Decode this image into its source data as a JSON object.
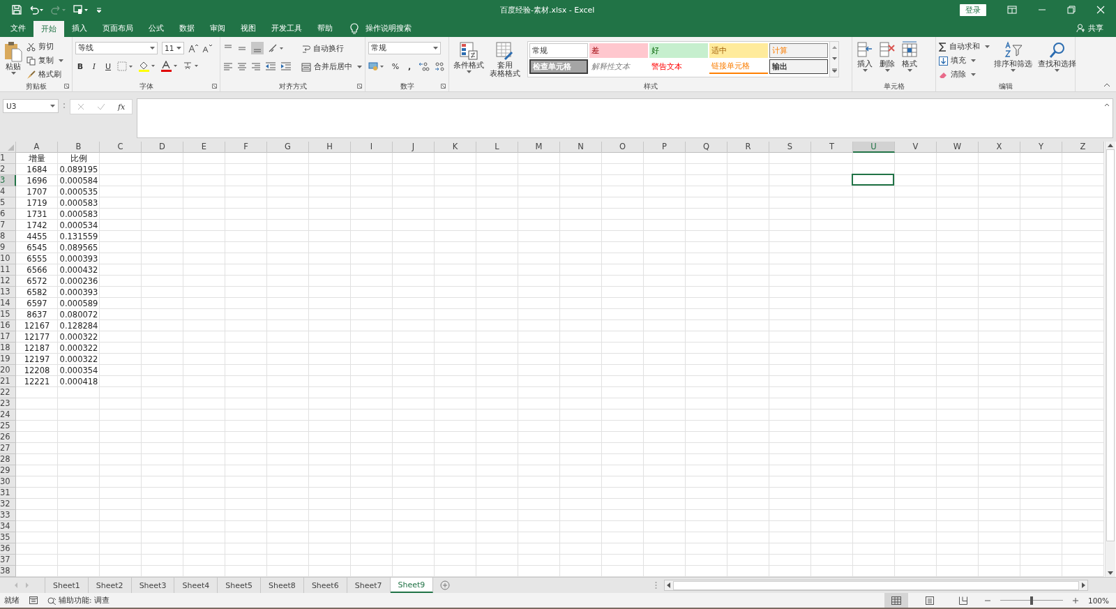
{
  "title_bar": {
    "title": "百度经验-素材.xlsx  -  Excel",
    "login": "登录"
  },
  "menu": {
    "tabs": [
      {
        "label": "文件",
        "selected": false
      },
      {
        "label": "开始",
        "selected": true
      },
      {
        "label": "插入",
        "selected": false
      },
      {
        "label": "页面布局",
        "selected": false
      },
      {
        "label": "公式",
        "selected": false
      },
      {
        "label": "数据",
        "selected": false
      },
      {
        "label": "审阅",
        "selected": false
      },
      {
        "label": "视图",
        "selected": false
      },
      {
        "label": "开发工具",
        "selected": false
      },
      {
        "label": "帮助",
        "selected": false
      }
    ],
    "search": "操作说明搜索",
    "share": "共享"
  },
  "ribbon": {
    "clipboard": {
      "paste": "粘贴",
      "cut": "剪切",
      "copy": "复制",
      "format_painter": "格式刷",
      "label": "剪贴板"
    },
    "font": {
      "font_name": "等线",
      "font_size": "11",
      "bold": "B",
      "italic": "I",
      "underline": "U",
      "label": "字体"
    },
    "alignment": {
      "wrap_text": "自动换行",
      "merge_center": "合并后居中",
      "label": "对齐方式"
    },
    "number": {
      "format": "常规",
      "percent": "%",
      "comma": ",",
      "label": "数字"
    },
    "styles": {
      "conditional_format": "条件格式",
      "table_format": [
        "套用",
        "表格格式"
      ],
      "cell_styles": [
        {
          "label": "常规",
          "kind": "normal"
        },
        {
          "label": "差",
          "kind": "bad"
        },
        {
          "label": "好",
          "kind": "good"
        },
        {
          "label": "适中",
          "kind": "neutral"
        },
        {
          "label": "计算",
          "kind": "calculation"
        },
        {
          "label": "检查单元格",
          "kind": "check"
        },
        {
          "label": "解释性文本",
          "kind": "explanatory"
        },
        {
          "label": "警告文本",
          "kind": "warning"
        },
        {
          "label": "链接单元格",
          "kind": "linked"
        },
        {
          "label": "输出",
          "kind": "output"
        }
      ],
      "label": "样式"
    },
    "cells": {
      "insert": "插入",
      "delete": "删除",
      "format": "格式",
      "label": "单元格"
    },
    "editing": {
      "autosum": "自动求和",
      "fill": "填充",
      "clear": "清除",
      "sort_filter": "排序和筛选",
      "find_select": "查找和选择",
      "label": "编辑"
    }
  },
  "formula_bar": {
    "name_box": "U3",
    "fx": "fx"
  },
  "sheet": {
    "columns": [
      {
        "label": "A",
        "selected": false
      },
      {
        "label": "B",
        "selected": false
      },
      {
        "label": "C",
        "selected": false
      },
      {
        "label": "D",
        "selected": false
      },
      {
        "label": "E",
        "selected": false
      },
      {
        "label": "F",
        "selected": false
      },
      {
        "label": "G",
        "selected": false
      },
      {
        "label": "H",
        "selected": false
      },
      {
        "label": "I",
        "selected": false
      },
      {
        "label": "J",
        "selected": false
      },
      {
        "label": "K",
        "selected": false
      },
      {
        "label": "L",
        "selected": false
      },
      {
        "label": "M",
        "selected": false
      },
      {
        "label": "N",
        "selected": false
      },
      {
        "label": "O",
        "selected": false
      },
      {
        "label": "P",
        "selected": false
      },
      {
        "label": "Q",
        "selected": false
      },
      {
        "label": "R",
        "selected": false
      },
      {
        "label": "S",
        "selected": false
      },
      {
        "label": "T",
        "selected": false
      },
      {
        "label": "U",
        "selected": true
      },
      {
        "label": "V",
        "selected": false
      },
      {
        "label": "W",
        "selected": false
      },
      {
        "label": "X",
        "selected": false
      },
      {
        "label": "Y",
        "selected": false
      },
      {
        "label": "Z",
        "selected": false
      }
    ],
    "rows": [
      {
        "label": "1",
        "selected": false,
        "cells": [
          "增量",
          "比例"
        ]
      },
      {
        "label": "2",
        "selected": false,
        "cells": [
          "1684",
          "0.089195"
        ]
      },
      {
        "label": "3",
        "selected": true,
        "cells": [
          "1696",
          "0.000584"
        ]
      },
      {
        "label": "4",
        "selected": false,
        "cells": [
          "1707",
          "0.000535"
        ]
      },
      {
        "label": "5",
        "selected": false,
        "cells": [
          "1719",
          "0.000583"
        ]
      },
      {
        "label": "6",
        "selected": false,
        "cells": [
          "1731",
          "0.000583"
        ]
      },
      {
        "label": "7",
        "selected": false,
        "cells": [
          "1742",
          "0.000534"
        ]
      },
      {
        "label": "8",
        "selected": false,
        "cells": [
          "4455",
          "0.131559"
        ]
      },
      {
        "label": "9",
        "selected": false,
        "cells": [
          "6545",
          "0.089565"
        ]
      },
      {
        "label": "10",
        "selected": false,
        "cells": [
          "6555",
          "0.000393"
        ]
      },
      {
        "label": "11",
        "selected": false,
        "cells": [
          "6566",
          "0.000432"
        ]
      },
      {
        "label": "12",
        "selected": false,
        "cells": [
          "6572",
          "0.000236"
        ]
      },
      {
        "label": "13",
        "selected": false,
        "cells": [
          "6582",
          "0.000393"
        ]
      },
      {
        "label": "14",
        "selected": false,
        "cells": [
          "6597",
          "0.000589"
        ]
      },
      {
        "label": "15",
        "selected": false,
        "cells": [
          "8637",
          "0.080072"
        ]
      },
      {
        "label": "16",
        "selected": false,
        "cells": [
          "12167",
          "0.128284"
        ]
      },
      {
        "label": "17",
        "selected": false,
        "cells": [
          "12177",
          "0.000322"
        ]
      },
      {
        "label": "18",
        "selected": false,
        "cells": [
          "12187",
          "0.000322"
        ]
      },
      {
        "label": "19",
        "selected": false,
        "cells": [
          "12197",
          "0.000322"
        ]
      },
      {
        "label": "20",
        "selected": false,
        "cells": [
          "12208",
          "0.000354"
        ]
      },
      {
        "label": "21",
        "selected": false,
        "cells": [
          "12221",
          "0.000418"
        ]
      },
      {
        "label": "22",
        "selected": false
      },
      {
        "label": "23",
        "selected": false
      },
      {
        "label": "24",
        "selected": false
      },
      {
        "label": "25",
        "selected": false
      },
      {
        "label": "26",
        "selected": false
      },
      {
        "label": "27",
        "selected": false
      },
      {
        "label": "28",
        "selected": false
      },
      {
        "label": "29",
        "selected": false
      },
      {
        "label": "30",
        "selected": false
      },
      {
        "label": "31",
        "selected": false
      },
      {
        "label": "32",
        "selected": false
      },
      {
        "label": "33",
        "selected": false
      },
      {
        "label": "34",
        "selected": false
      },
      {
        "label": "35",
        "selected": false
      },
      {
        "label": "36",
        "selected": false
      },
      {
        "label": "37",
        "selected": false
      },
      {
        "label": "38",
        "selected": false
      }
    ]
  },
  "sheet_tabs": [
    {
      "label": "Sheet1",
      "selected": false
    },
    {
      "label": "Sheet2",
      "selected": false
    },
    {
      "label": "Sheet3",
      "selected": false
    },
    {
      "label": "Sheet4",
      "selected": false
    },
    {
      "label": "Sheet5",
      "selected": false
    },
    {
      "label": "Sheet8",
      "selected": false
    },
    {
      "label": "Sheet6",
      "selected": false
    },
    {
      "label": "Sheet7",
      "selected": false
    },
    {
      "label": "Sheet9",
      "selected": true
    }
  ],
  "status_bar": {
    "ready": "就绪",
    "accessibility": "辅助功能: 调查",
    "views": [
      {
        "kind": "normal",
        "selected": true
      },
      {
        "kind": "page_layout",
        "selected": false
      },
      {
        "kind": "page_break",
        "selected": false
      }
    ],
    "zoom_slider": {
      "level": 0.5
    },
    "zoom": "100%"
  }
}
